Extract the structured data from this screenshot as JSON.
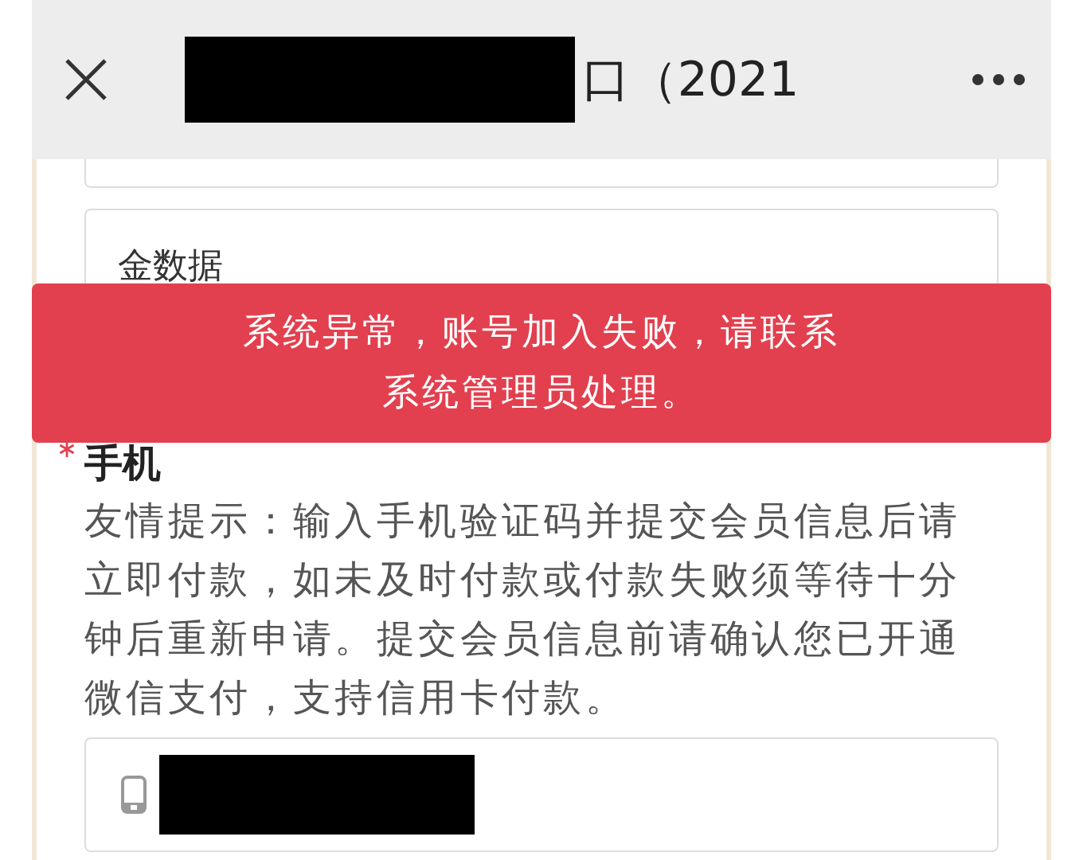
{
  "header": {
    "title": "口（2021"
  },
  "form": {
    "source_field": {
      "value": "金数据"
    },
    "phone": {
      "label": "手机",
      "required": true,
      "hint": "友情提示：输入手机验证码并提交会员信息后请立即付款，如未及时付款或付款失败须等待十分钟后重新申请。提交会员信息前请确认您已开通微信支付，支持信用卡付款。"
    }
  },
  "toast": {
    "message": "系统异常，账号加入失败，请联系系统管理员处理。",
    "kind": "error"
  }
}
